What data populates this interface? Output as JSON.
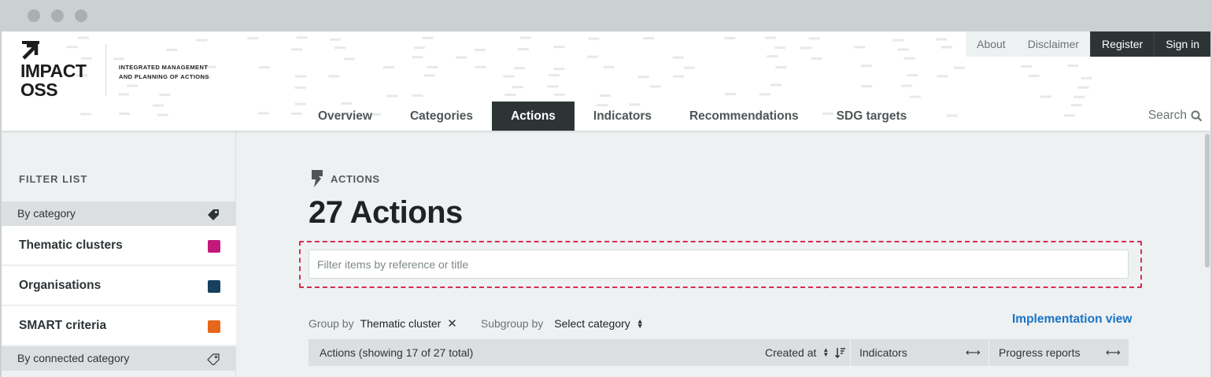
{
  "browser": {
    "dots": [
      "close",
      "minimize",
      "maximize"
    ]
  },
  "brand": {
    "logo_line1": "IMPACT",
    "logo_line2": "OSS",
    "tagline_line1": "INTEGRATED MANAGEMENT",
    "tagline_line2": "AND PLANNING OF ACTIONS"
  },
  "topnav": {
    "about": "About",
    "disclaimer": "Disclaimer",
    "register": "Register",
    "signin": "Sign in"
  },
  "mainnav": {
    "items": [
      "Overview",
      "Categories",
      "Actions",
      "Indicators",
      "Recommendations",
      "SDG targets"
    ],
    "active": "Actions",
    "search_label": "Search"
  },
  "sidebar": {
    "title": "FILTER LIST",
    "by_category": "By category",
    "categories": [
      {
        "label": "Thematic clusters",
        "color": "#c2187a"
      },
      {
        "label": "Organisations",
        "color": "#17405f"
      },
      {
        "label": "SMART criteria",
        "color": "#e8661a"
      }
    ],
    "by_connected": "By connected category"
  },
  "content": {
    "section_label": "ACTIONS",
    "title": "27 Actions",
    "filter_placeholder": "Filter items by reference or title",
    "group_by_label": "Group by",
    "group_by_value": "Thematic cluster",
    "subgroup_label": "Subgroup by",
    "subgroup_value": "Select category",
    "implementation_view": "Implementation view",
    "table": {
      "actions_header": "Actions (showing 17 of 27 total)",
      "created_at": "Created at",
      "indicators": "Indicators",
      "progress_reports": "Progress reports"
    }
  },
  "colors": {
    "accent_dark": "#2d3436",
    "highlight_dashed": "#d82951",
    "link": "#1a73c7"
  }
}
